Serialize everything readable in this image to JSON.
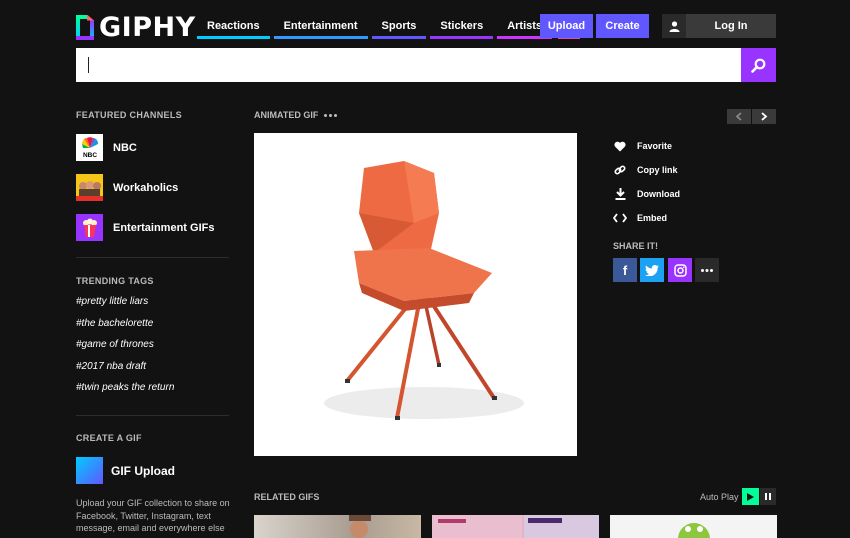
{
  "brand": {
    "name": "GIPHY"
  },
  "nav": {
    "items": [
      {
        "label": "Reactions",
        "color": "#00ccff"
      },
      {
        "label": "Entertainment",
        "color": "#3399ff"
      },
      {
        "label": "Sports",
        "color": "#6157ff"
      },
      {
        "label": "Stickers",
        "color": "#9933ff"
      },
      {
        "label": "Artists",
        "color": "#cc33ff"
      }
    ],
    "more_color": "#e646b6"
  },
  "header": {
    "upload_label": "Upload",
    "create_label": "Create",
    "login_label": "Log In"
  },
  "search": {
    "value": "",
    "placeholder": ""
  },
  "sidebar": {
    "featured_heading": "FEATURED CHANNELS",
    "channels": [
      {
        "name": "NBC",
        "icon": "nbc-peacock-icon"
      },
      {
        "name": "Workaholics",
        "icon": "workaholics-icon"
      },
      {
        "name": "Entertainment GIFs",
        "icon": "popcorn-icon"
      }
    ],
    "trending_heading": "TRENDING TAGS",
    "tags": [
      "#pretty little liars",
      "#the bachelorette",
      "#game of thrones",
      "#2017 nba draft",
      "#twin peaks the return"
    ],
    "create_heading": "CREATE A GIF",
    "gif_upload_label": "GIF Upload",
    "gif_upload_desc": "Upload your GIF collection to share on Facebook, Twitter, Instagram, text message, email and everywhere else"
  },
  "main": {
    "heading": "ANIMATED GIF",
    "gif_subject": "orange chair",
    "actions": [
      {
        "label": "Favorite",
        "icon": "heart-icon"
      },
      {
        "label": "Copy link",
        "icon": "link-icon"
      },
      {
        "label": "Download",
        "icon": "download-icon"
      },
      {
        "label": "Embed",
        "icon": "embed-icon"
      }
    ],
    "share_label": "SHARE IT!",
    "share": [
      {
        "icon": "facebook-icon",
        "color": "#3b5998",
        "glyph": "f"
      },
      {
        "icon": "twitter-icon",
        "color": "#1da1f2",
        "glyph": "t"
      },
      {
        "icon": "instagram-icon",
        "color": "#9933ff",
        "glyph": "◎"
      },
      {
        "icon": "more-icon",
        "color": "#2a2a2a",
        "glyph": "•••"
      }
    ],
    "related_heading": "RELATED GIFS",
    "autoplay_label": "Auto Play"
  }
}
